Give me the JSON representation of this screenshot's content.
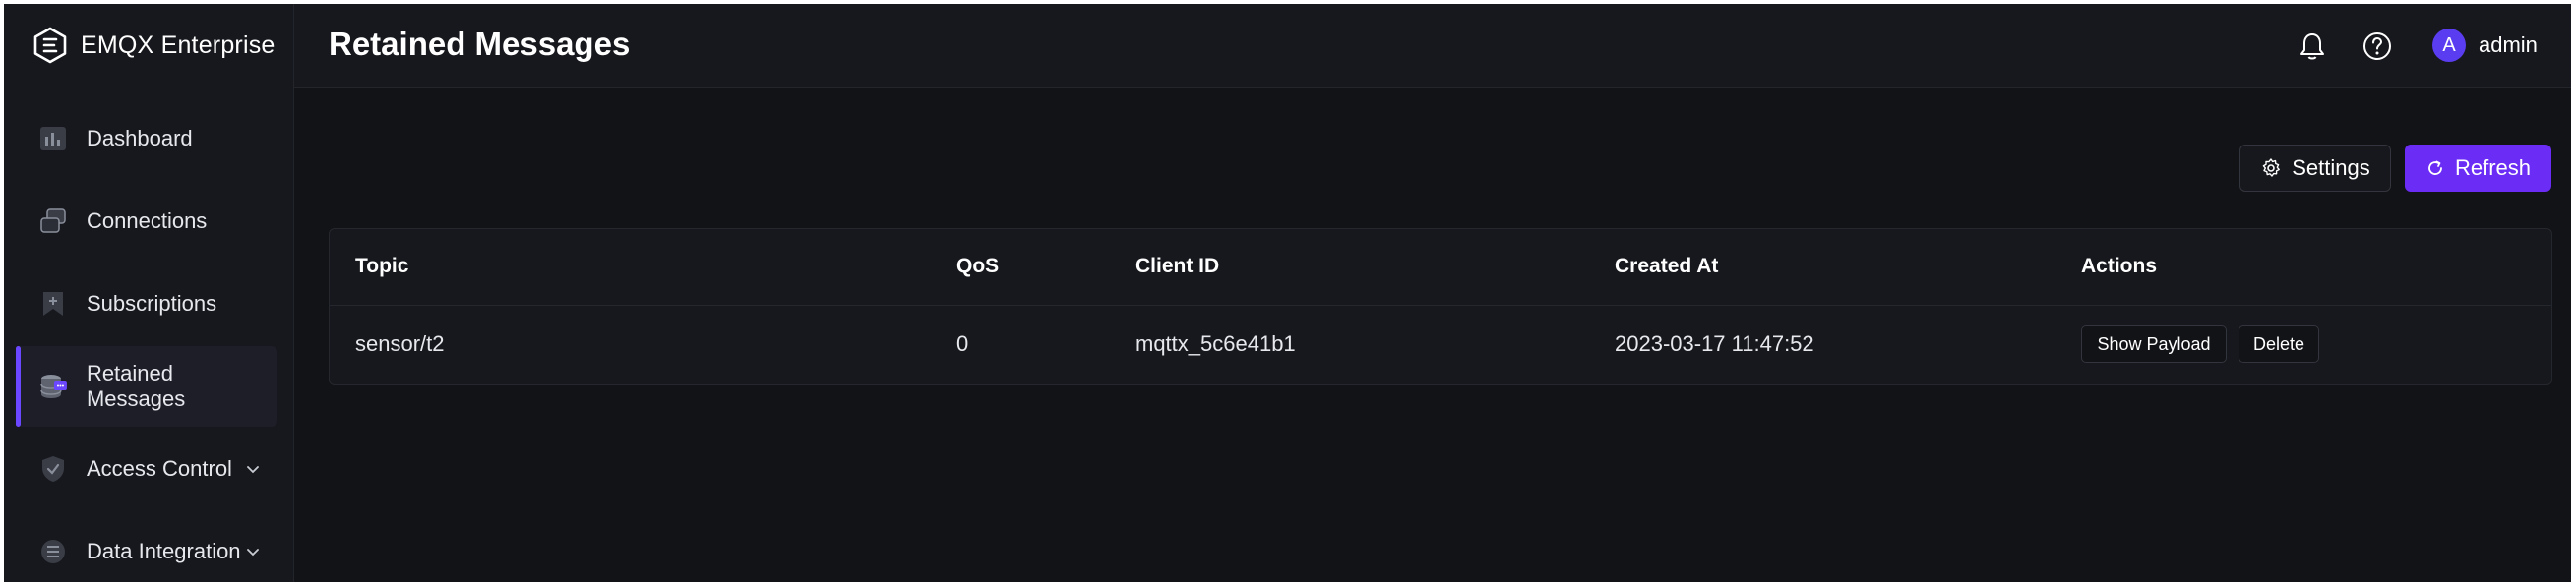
{
  "app": {
    "name": "EMQX Enterprise"
  },
  "colors": {
    "accent": "#6b2cf5",
    "active_bar": "#6b48ff",
    "background": "#121317",
    "panel": "#17181d"
  },
  "sidebar": {
    "items": [
      {
        "label": "Dashboard",
        "icon": "dashboard-icon"
      },
      {
        "label": "Connections",
        "icon": "connections-icon"
      },
      {
        "label": "Subscriptions",
        "icon": "subscriptions-icon"
      },
      {
        "label": "Retained Messages",
        "icon": "retained-messages-icon",
        "active": true
      },
      {
        "label": "Access Control",
        "icon": "shield-icon",
        "expandable": true
      },
      {
        "label": "Data Integration",
        "icon": "data-integration-icon",
        "expandable": true
      }
    ]
  },
  "header": {
    "title": "Retained Messages",
    "avatar_letter": "A",
    "username": "admin"
  },
  "toolbar": {
    "settings_label": "Settings",
    "refresh_label": "Refresh"
  },
  "table": {
    "columns": [
      "Topic",
      "QoS",
      "Client ID",
      "Created At",
      "Actions"
    ],
    "rows": [
      {
        "topic": "sensor/t2",
        "qos": "0",
        "client_id": "mqttx_5c6e41b1",
        "created_at": "2023-03-17 11:47:52",
        "actions": [
          "Show Payload",
          "Delete"
        ]
      }
    ]
  }
}
